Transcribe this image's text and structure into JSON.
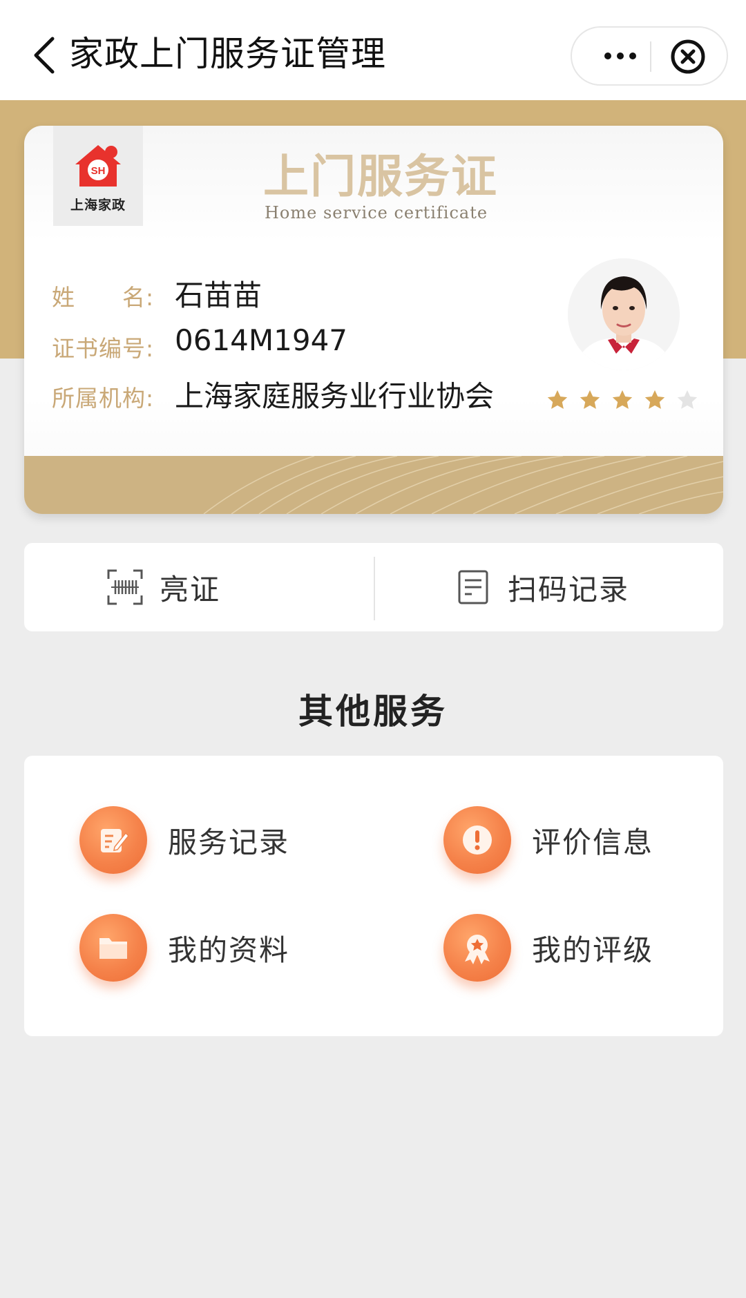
{
  "navbar": {
    "title": "家政上门服务证管理"
  },
  "card": {
    "logo_text": "上海家政",
    "logo_badge": "SH",
    "heading": "上门服务证",
    "subheading": "Home service certificate",
    "fields": [
      {
        "label": "姓　　名:",
        "value": "石苗苗"
      },
      {
        "label": "证书编号:",
        "value": "0614M1947"
      },
      {
        "label": "所属机构:",
        "value": "上海家庭服务业行业协会"
      }
    ],
    "rating": {
      "filled": 4,
      "total": 5
    }
  },
  "actions": {
    "show_cert": "亮证",
    "scan_records": "扫码记录"
  },
  "other_services": {
    "title": "其他服务",
    "items": [
      {
        "label": "服务记录",
        "icon": "edit-document-icon"
      },
      {
        "label": "评价信息",
        "icon": "exclamation-icon"
      },
      {
        "label": "我的资料",
        "icon": "folder-icon"
      },
      {
        "label": "我的评级",
        "icon": "award-medal-icon"
      }
    ]
  },
  "colors": {
    "gold": "#d1b37a",
    "label_gold": "#c9a877",
    "orange": "#f5824a",
    "background": "#ededed"
  }
}
